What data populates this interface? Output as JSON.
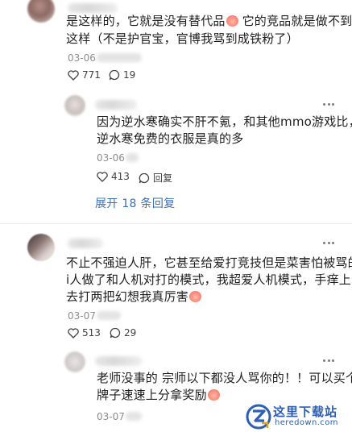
{
  "comments": [
    {
      "line1": "是这样的，它就是没有替代品",
      "line1b": " 它的竞品就是做不到",
      "line2": "这样（不是护官宝，官博我骂到成铁粉了）",
      "date": "03-06",
      "likes": "771",
      "replies": "19",
      "emoji_icon": "crying-pig-emoji-icon"
    },
    {
      "line1": "因为逆水寒确实不肝不氪，和其他mmo游戏比，",
      "line2": "逆水寒免费的衣服是真的多",
      "date": "03-06",
      "likes": "413",
      "reply_label": "回复"
    },
    {
      "expand_label": "展开 18 条回复"
    },
    {
      "line1": "不止不强迫人肝，它甚至给爱打竞技但是菜害怕被骂的",
      "line2": "i人做了和人机对打的模式，我超爱人机模式，手痒上",
      "line3": "去打两把幻想我真厉害",
      "date": "03-07",
      "likes": "513",
      "replies": "29"
    },
    {
      "line1": "老师没事的 宗师以下都没人骂你的！！可以买个",
      "line2": "牌子速速上分拿奖励",
      "date": "03-07"
    }
  ],
  "watermark": {
    "title": "这里下载站",
    "url": "heredown.com"
  },
  "colors": {
    "link": "#3b6fb6",
    "meta": "#8c8c8c",
    "watermark": "#2d5fb5"
  }
}
